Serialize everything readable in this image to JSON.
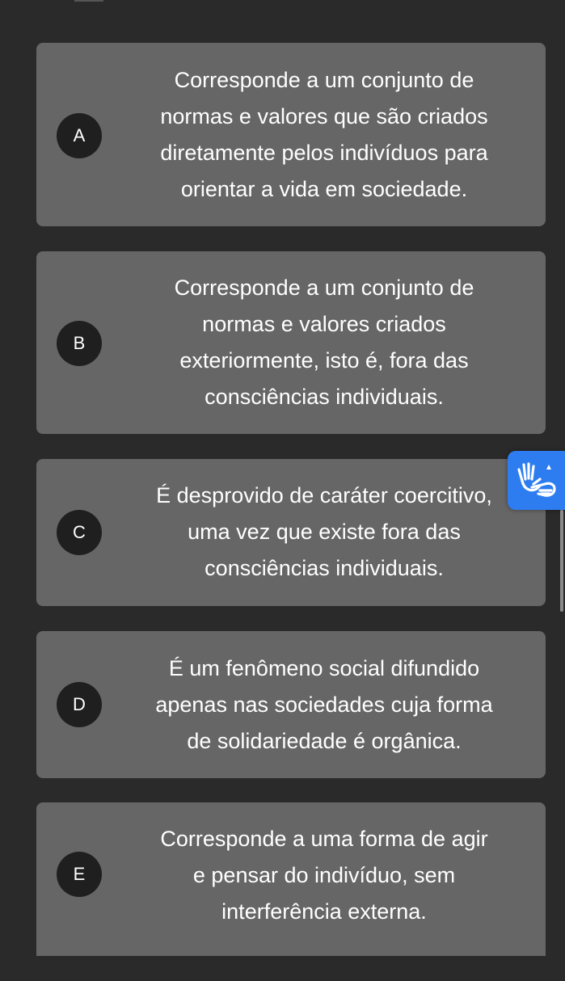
{
  "options": [
    {
      "letter": "A",
      "text": "Corresponde a um conjunto de\nnormas e valores que são criados\ndiretamente pelos indivíduos para\norientar a vida em sociedade."
    },
    {
      "letter": "B",
      "text": "Corresponde a um conjunto de\nnormas e valores criados\nexteriormente, isto é, fora das\nconsciências individuais."
    },
    {
      "letter": "C",
      "text": "É desprovido de caráter coercitivo,\numa vez que existe fora das\nconsciências individuais."
    },
    {
      "letter": "D",
      "text": "É um fenômeno social difundido\napenas nas sociedades cuja forma\nde solidariedade é orgânica."
    },
    {
      "letter": "E",
      "text": "Corresponde a uma forma de agir\ne pensar do indivíduo, sem\ninterferência externa."
    }
  ],
  "accessibility_widget": {
    "icon": "sign-language-hands-icon",
    "color": "#2e7df0"
  },
  "colors": {
    "background": "#2a2a2a",
    "card": "#666666",
    "letter_circle": "#1f1f1f",
    "text": "#ffffff"
  }
}
